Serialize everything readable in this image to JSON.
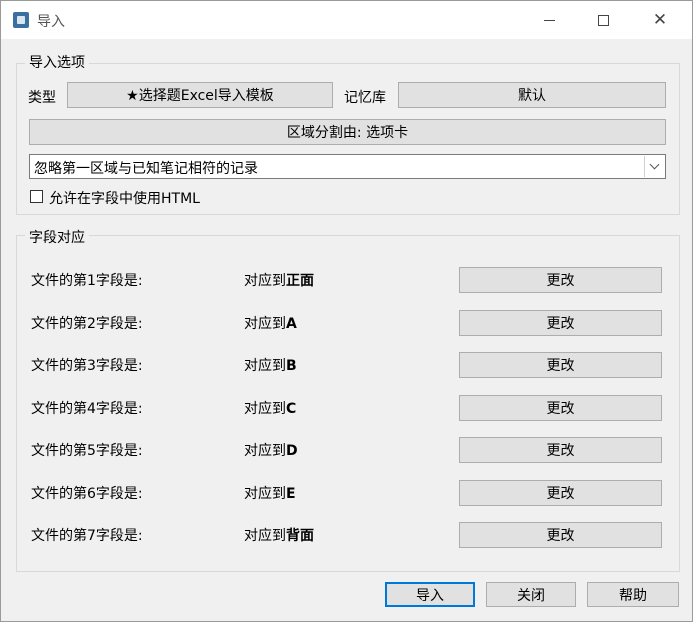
{
  "window": {
    "title": "导入"
  },
  "import_options": {
    "group_label": "导入选项",
    "type_label": "类型",
    "type_button": "★选择题Excel导入模板",
    "deck_label": "记忆库",
    "deck_button": "默认",
    "separator_button": "区域分割由: 选项卡",
    "duplicate_mode": "忽略第一区域与已知笔记相符的记录",
    "allow_html_label": "允许在字段中使用HTML"
  },
  "field_mapping": {
    "group_label": "字段对应",
    "change_label": "更改",
    "rows": [
      {
        "source": "文件的第1字段是:",
        "target_prefix": "对应到",
        "target": "正面"
      },
      {
        "source": "文件的第2字段是:",
        "target_prefix": "对应到",
        "target": "A"
      },
      {
        "source": "文件的第3字段是:",
        "target_prefix": "对应到",
        "target": "B"
      },
      {
        "source": "文件的第4字段是:",
        "target_prefix": "对应到",
        "target": "C"
      },
      {
        "source": "文件的第5字段是:",
        "target_prefix": "对应到",
        "target": "D"
      },
      {
        "source": "文件的第6字段是:",
        "target_prefix": "对应到",
        "target": "E"
      },
      {
        "source": "文件的第7字段是:",
        "target_prefix": "对应到",
        "target": "背面"
      }
    ]
  },
  "footer": {
    "import_button": "导入",
    "close_button": "关闭",
    "help_button": "帮助"
  }
}
